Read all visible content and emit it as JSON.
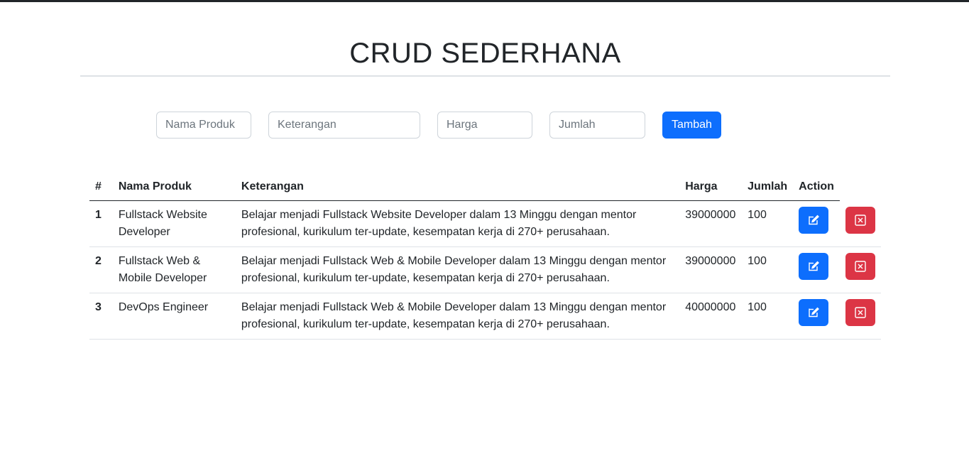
{
  "page": {
    "title": "CRUD SEDERHANA"
  },
  "form": {
    "nama_placeholder": "Nama Produk",
    "keterangan_placeholder": "Keterangan",
    "harga_placeholder": "Harga",
    "jumlah_placeholder": "Jumlah",
    "submit_label": "Tambah"
  },
  "table": {
    "headers": {
      "no": "#",
      "nama": "Nama Produk",
      "keterangan": "Keterangan",
      "harga": "Harga",
      "jumlah": "Jumlah",
      "action": "Action"
    },
    "rows": [
      {
        "no": "1",
        "nama": "Fullstack Website Developer",
        "keterangan": "Belajar menjadi Fullstack Website Developer dalam 13 Minggu dengan mentor profesional, kurikulum ter-update, kesempatan kerja di 270+ perusahaan.",
        "harga": "39000000",
        "jumlah": "100"
      },
      {
        "no": "2",
        "nama": "Fullstack Web & Mobile Developer",
        "keterangan": "Belajar menjadi Fullstack Web & Mobile Developer dalam 13 Minggu dengan mentor profesional, kurikulum ter-update, kesempatan kerja di 270+ perusahaan.",
        "harga": "39000000",
        "jumlah": "100"
      },
      {
        "no": "3",
        "nama": "DevOps Engineer",
        "keterangan": "Belajar menjadi Fullstack Web & Mobile Developer dalam 13 Minggu dengan mentor profesional, kurikulum ter-update, kesempatan kerja di 270+ perusahaan.",
        "harga": "40000000",
        "jumlah": "100"
      }
    ]
  },
  "icons": {
    "edit": "edit-icon",
    "delete": "close-square-icon"
  },
  "colors": {
    "primary": "#0d6efd",
    "danger": "#dc3545",
    "text": "#212529"
  }
}
